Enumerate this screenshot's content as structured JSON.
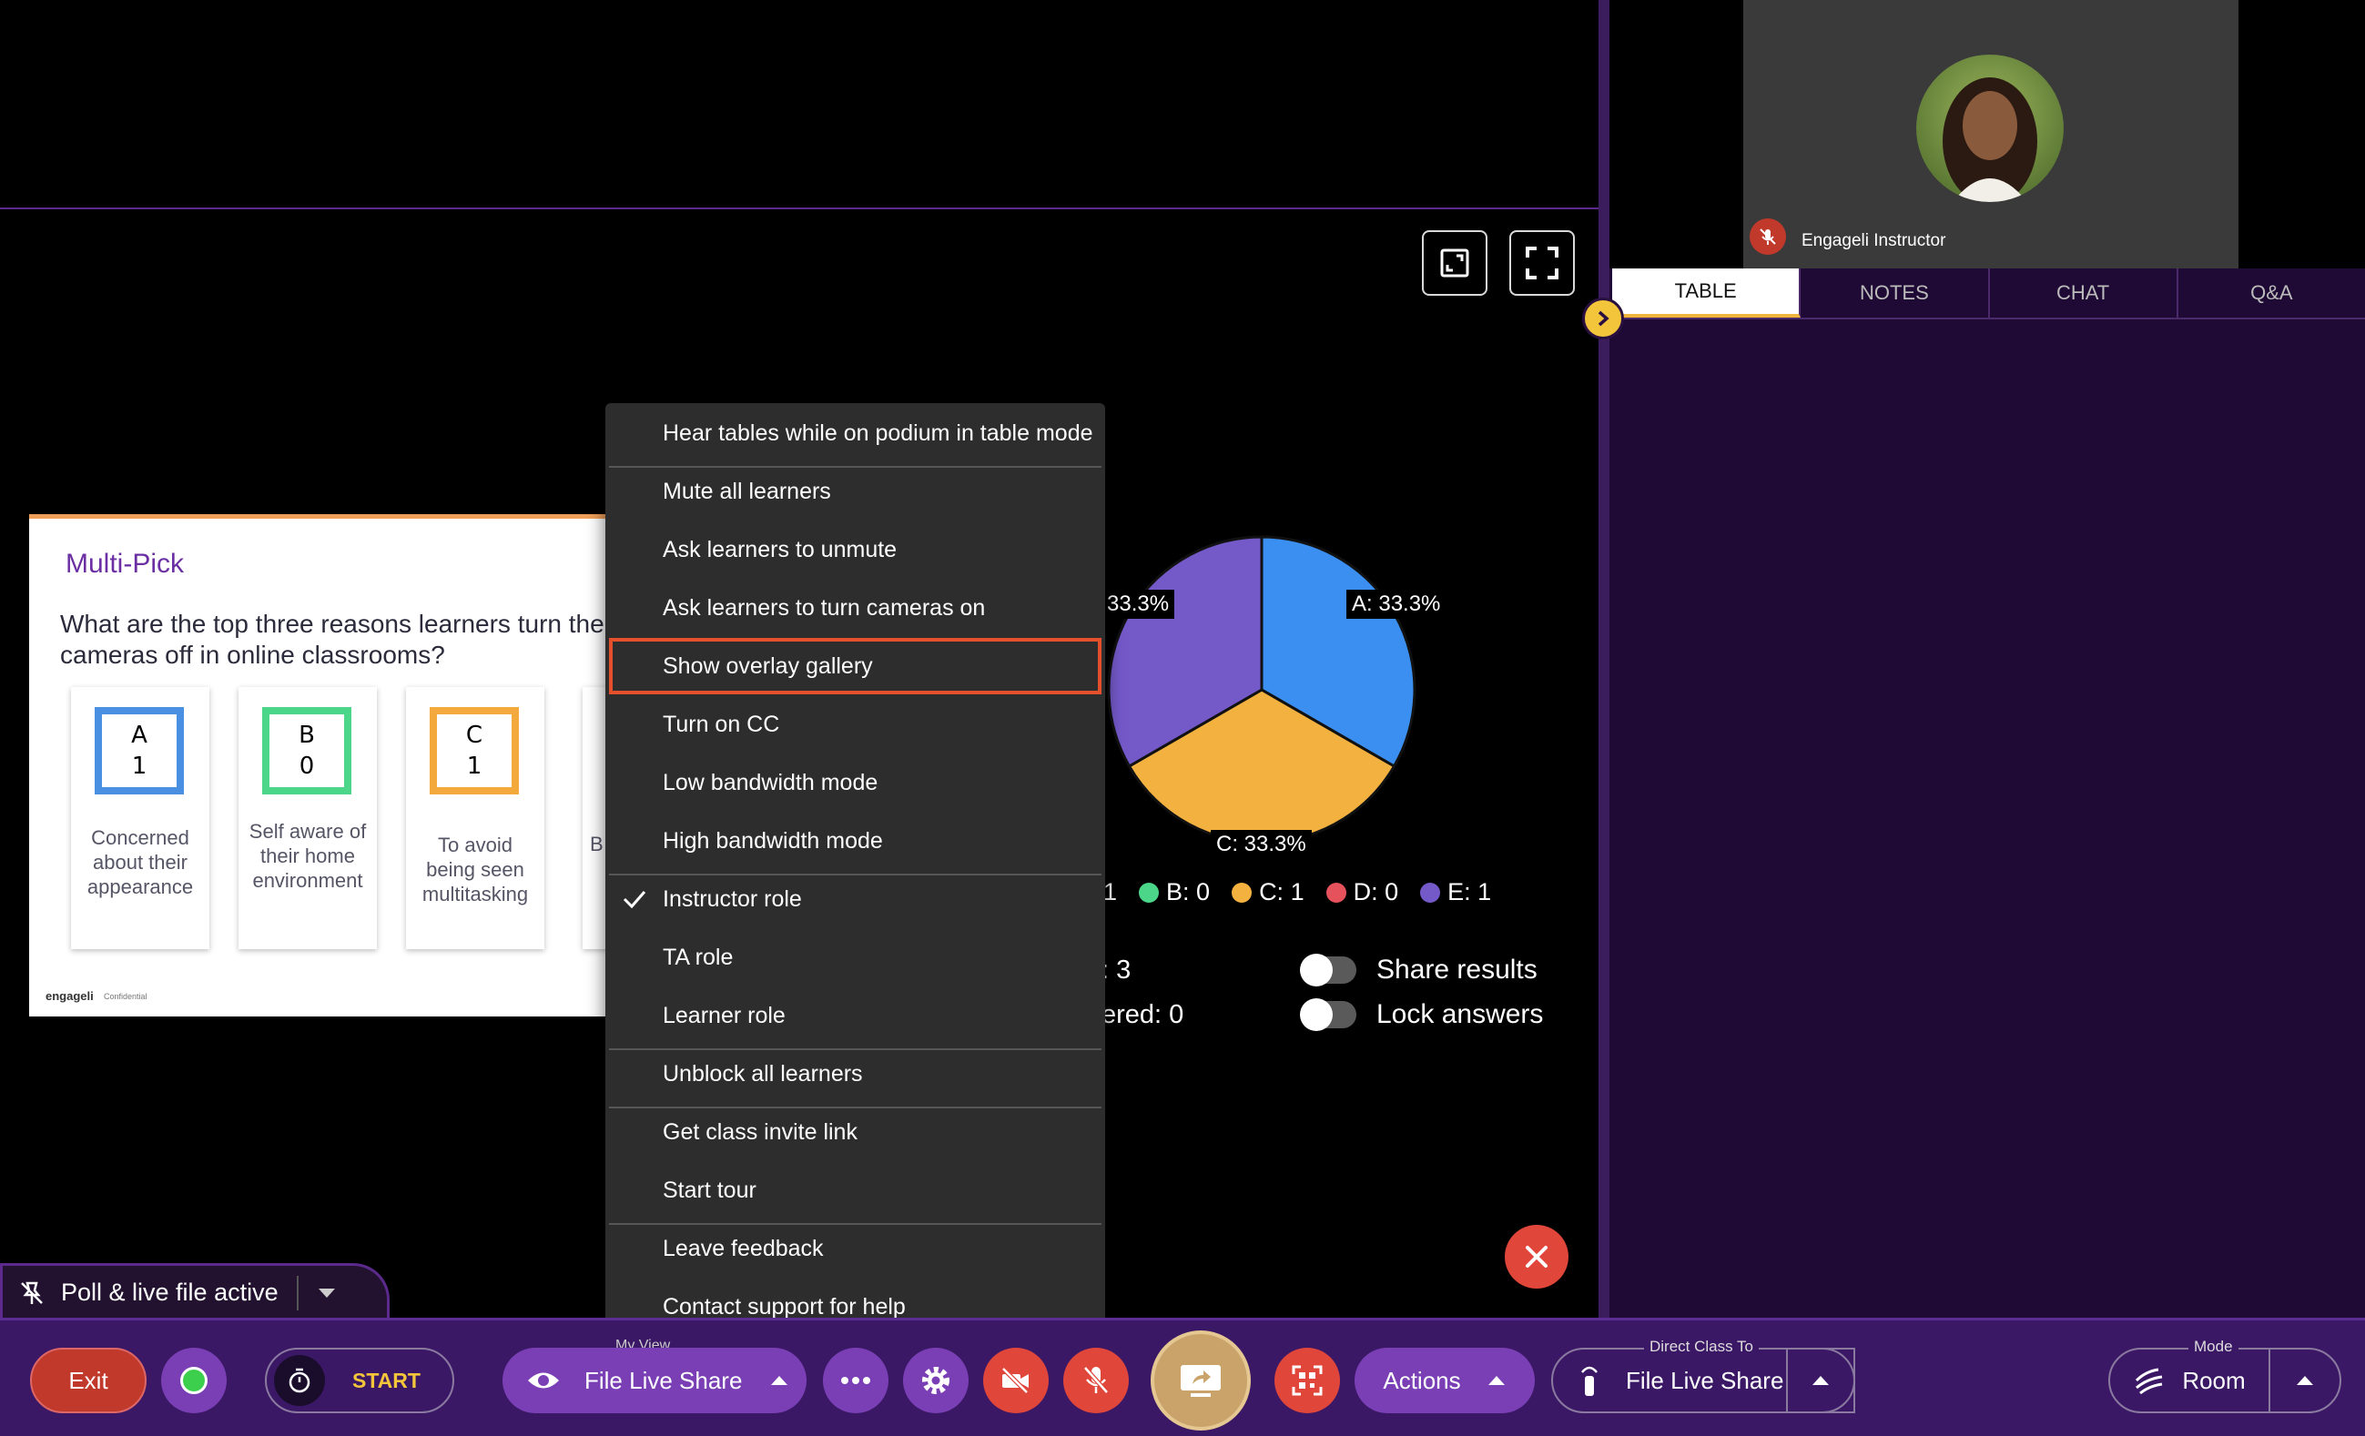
{
  "slide": {
    "heading": "Multi-Pick",
    "question": "What are the top three reasons learners turn their cameras off in online classrooms?",
    "options": [
      {
        "letter": "A",
        "count": "1",
        "desc": "Concerned about their appearance",
        "color": "#4a90e2"
      },
      {
        "letter": "B",
        "count": "0",
        "desc": "Self aware of their home environment",
        "color": "#4cd68a"
      },
      {
        "letter": "C",
        "count": "1",
        "desc": "To avoid being seen multitasking",
        "color": "#f3a93b"
      }
    ],
    "partial_option_letter": "B",
    "logo": "engageli",
    "footer": "Confidential"
  },
  "poll": {
    "pie_labels": {
      "a": "A: 33.3%",
      "c": "C: 33.3%",
      "e": "33.3%"
    },
    "legend": [
      {
        "label": "1",
        "color": "#4a90e2"
      },
      {
        "label": "B: 0",
        "color": "#4cd68a"
      },
      {
        "label": "C: 1",
        "color": "#f3b23f"
      },
      {
        "label": "D: 0",
        "color": "#e5525c"
      },
      {
        "label": "E: 1",
        "color": "#7459c9"
      }
    ],
    "stat_total": ": 3",
    "stat_unanswered": "ered: 0",
    "share_results": "Share results",
    "lock_answers": "Lock answers"
  },
  "chart_data": {
    "type": "pie",
    "categories": [
      "A",
      "B",
      "C",
      "D",
      "E"
    ],
    "values": [
      1,
      0,
      1,
      0,
      1
    ],
    "colors": [
      "#3b8ff0",
      "#4cd68a",
      "#f3b23f",
      "#e5525c",
      "#7459c9"
    ]
  },
  "menu": {
    "items": [
      "Hear tables while on podium in table mode",
      "Mute all learners",
      "Ask learners to unmute",
      "Ask learners to turn cameras on",
      "Show overlay gallery",
      "Turn on CC",
      "Low bandwidth mode",
      "High bandwidth mode",
      "Instructor role",
      "TA role",
      "Learner role",
      "Unblock all learners",
      "Get class invite link",
      "Start tour",
      "Leave feedback",
      "Contact support for help"
    ],
    "checked_item": "Instructor role",
    "highlighted_item": "Show overlay gallery"
  },
  "status": {
    "text": "Poll & live file active"
  },
  "instructor": {
    "name": "Engageli Instructor"
  },
  "tabs": [
    "TABLE",
    "NOTES",
    "CHAT",
    "Q&A"
  ],
  "active_tab": "TABLE",
  "toolbar": {
    "exit": "Exit",
    "timer_start": "START",
    "my_view_label": "My View",
    "file_live_share": "File Live Share",
    "actions": "Actions",
    "direct_class_label": "Direct Class To",
    "direct_class_value": "File Live Share",
    "mode_label": "Mode",
    "mode_value": "Room"
  },
  "colors": {
    "toolbar_bg": "#3b1866",
    "accent_purple": "#7a3fb5",
    "danger_red": "#e0463a",
    "tab_active_underline": "#f3b43b",
    "menu_highlight": "#e4502c"
  }
}
